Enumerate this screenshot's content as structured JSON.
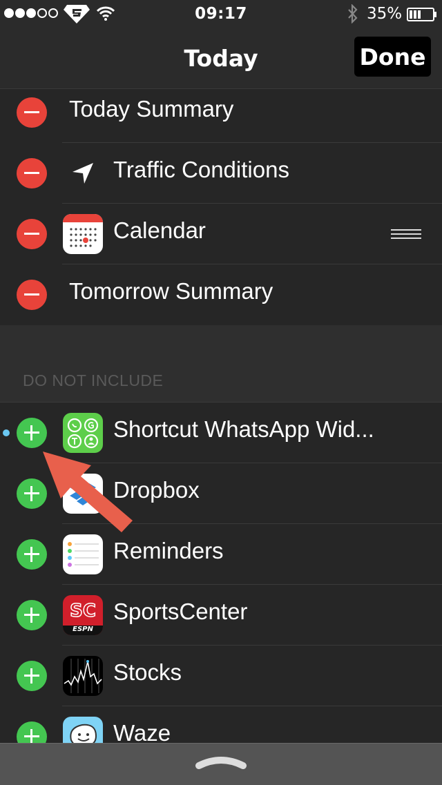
{
  "status_bar": {
    "signal_bars_filled": 3,
    "signal_bars_total": 5,
    "carrier_icon": "superman-logo-icon",
    "wifi_icon": "wifi-icon",
    "time": "09:17",
    "bluetooth_icon": "bluetooth-icon",
    "battery_percent": "35%",
    "battery_icon": "battery-icon"
  },
  "nav": {
    "title": "Today",
    "done_label": "Done"
  },
  "included_widgets": [
    {
      "label": "Today Summary",
      "icon": null
    },
    {
      "label": "Traffic Conditions",
      "icon": "location-arrow-icon"
    },
    {
      "label": "Calendar",
      "icon": "calendar-app-icon",
      "show_reorder_handle": true
    },
    {
      "label": "Tomorrow Summary",
      "icon": null
    }
  ],
  "excluded_section": {
    "header": "DO NOT INCLUDE",
    "items": [
      {
        "label": "Shortcut WhatsApp Wid...",
        "icon": "whatsapp-shortcut-app-icon",
        "new_indicator": true
      },
      {
        "label": "Dropbox",
        "icon": "dropbox-app-icon"
      },
      {
        "label": "Reminders",
        "icon": "reminders-app-icon"
      },
      {
        "label": "SportsCenter",
        "icon": "sportscenter-app-icon"
      },
      {
        "label": "Stocks",
        "icon": "stocks-app-icon"
      },
      {
        "label": "Waze",
        "icon": "waze-app-icon"
      }
    ]
  },
  "sportscenter_icon_text": {
    "sc": "SC",
    "brand": "ESPN"
  },
  "annotation": {
    "icon": "red-arrow-annotation",
    "color": "#e8604c"
  },
  "colors": {
    "remove_red": "#e8433a",
    "add_green": "#44c651",
    "indicator_blue": "#6bc8f2",
    "background": "#262626"
  },
  "bottom_bar": {
    "icon": "chevron-up-icon"
  }
}
